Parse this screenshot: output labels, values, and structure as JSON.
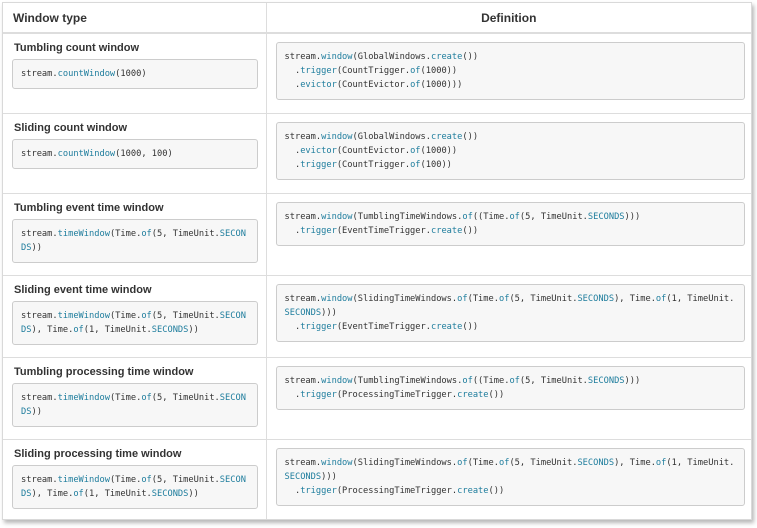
{
  "header": {
    "col1": "Window type",
    "col2": "Definition"
  },
  "rows": [
    {
      "title": "Tumbling count window",
      "example": [
        [
          "t",
          "stream."
        ],
        [
          "k",
          "countWindow"
        ],
        [
          "t",
          "(1000)"
        ]
      ],
      "definition": [
        [
          "t",
          "stream."
        ],
        [
          "k",
          "window"
        ],
        [
          "t",
          "(GlobalWindows."
        ],
        [
          "k",
          "create"
        ],
        [
          "t",
          "())\n  ."
        ],
        [
          "k",
          "trigger"
        ],
        [
          "t",
          "(CountTrigger."
        ],
        [
          "k",
          "of"
        ],
        [
          "t",
          "(1000))\n  ."
        ],
        [
          "k",
          "evictor"
        ],
        [
          "t",
          "(CountEvictor."
        ],
        [
          "k",
          "of"
        ],
        [
          "t",
          "(1000)))"
        ]
      ]
    },
    {
      "title": "Sliding count window",
      "example": [
        [
          "t",
          "stream."
        ],
        [
          "k",
          "countWindow"
        ],
        [
          "t",
          "(1000, 100)"
        ]
      ],
      "definition": [
        [
          "t",
          "stream."
        ],
        [
          "k",
          "window"
        ],
        [
          "t",
          "(GlobalWindows."
        ],
        [
          "k",
          "create"
        ],
        [
          "t",
          "())\n  ."
        ],
        [
          "k",
          "evictor"
        ],
        [
          "t",
          "(CountEvictor."
        ],
        [
          "k",
          "of"
        ],
        [
          "t",
          "(1000))\n  ."
        ],
        [
          "k",
          "trigger"
        ],
        [
          "t",
          "(CountTrigger."
        ],
        [
          "k",
          "of"
        ],
        [
          "t",
          "(100))"
        ]
      ]
    },
    {
      "title": "Tumbling event time window",
      "example": [
        [
          "t",
          "stream."
        ],
        [
          "k",
          "timeWindow"
        ],
        [
          "t",
          "(Time."
        ],
        [
          "k",
          "of"
        ],
        [
          "t",
          "(5, TimeUnit."
        ],
        [
          "k",
          "SECONDS"
        ],
        [
          "t",
          "))"
        ]
      ],
      "definition": [
        [
          "t",
          "stream."
        ],
        [
          "k",
          "window"
        ],
        [
          "t",
          "(TumblingTimeWindows."
        ],
        [
          "k",
          "of"
        ],
        [
          "t",
          "((Time."
        ],
        [
          "k",
          "of"
        ],
        [
          "t",
          "(5, TimeUnit."
        ],
        [
          "k",
          "SECONDS"
        ],
        [
          "t",
          ")))\n  ."
        ],
        [
          "k",
          "trigger"
        ],
        [
          "t",
          "(EventTimeTrigger."
        ],
        [
          "k",
          "create"
        ],
        [
          "t",
          "())"
        ]
      ]
    },
    {
      "title": "Sliding event time window",
      "example": [
        [
          "t",
          "stream."
        ],
        [
          "k",
          "timeWindow"
        ],
        [
          "t",
          "(Time."
        ],
        [
          "k",
          "of"
        ],
        [
          "t",
          "(5, TimeUnit."
        ],
        [
          "k",
          "SECONDS"
        ],
        [
          "t",
          "), Time."
        ],
        [
          "k",
          "of"
        ],
        [
          "t",
          "(1, TimeUnit."
        ],
        [
          "k",
          "SECONDS"
        ],
        [
          "t",
          "))"
        ]
      ],
      "definition": [
        [
          "t",
          "stream."
        ],
        [
          "k",
          "window"
        ],
        [
          "t",
          "(SlidingTimeWindows."
        ],
        [
          "k",
          "of"
        ],
        [
          "t",
          "(Time."
        ],
        [
          "k",
          "of"
        ],
        [
          "t",
          "(5, TimeUnit."
        ],
        [
          "k",
          "SECONDS"
        ],
        [
          "t",
          "), Time."
        ],
        [
          "k",
          "of"
        ],
        [
          "t",
          "(1, TimeUnit."
        ],
        [
          "k",
          "SECONDS"
        ],
        [
          "t",
          ")))\n  ."
        ],
        [
          "k",
          "trigger"
        ],
        [
          "t",
          "(EventTimeTrigger."
        ],
        [
          "k",
          "create"
        ],
        [
          "t",
          "())"
        ]
      ]
    },
    {
      "title": "Tumbling processing time window",
      "example": [
        [
          "t",
          "stream."
        ],
        [
          "k",
          "timeWindow"
        ],
        [
          "t",
          "(Time."
        ],
        [
          "k",
          "of"
        ],
        [
          "t",
          "(5, TimeUnit."
        ],
        [
          "k",
          "SECONDS"
        ],
        [
          "t",
          "))"
        ]
      ],
      "definition": [
        [
          "t",
          "stream."
        ],
        [
          "k",
          "window"
        ],
        [
          "t",
          "(TumblingTimeWindows."
        ],
        [
          "k",
          "of"
        ],
        [
          "t",
          "((Time."
        ],
        [
          "k",
          "of"
        ],
        [
          "t",
          "(5, TimeUnit."
        ],
        [
          "k",
          "SECONDS"
        ],
        [
          "t",
          ")))\n  ."
        ],
        [
          "k",
          "trigger"
        ],
        [
          "t",
          "(ProcessingTimeTrigger."
        ],
        [
          "k",
          "create"
        ],
        [
          "t",
          "())"
        ]
      ]
    },
    {
      "title": "Sliding processing time window",
      "example": [
        [
          "t",
          "stream."
        ],
        [
          "k",
          "timeWindow"
        ],
        [
          "t",
          "(Time."
        ],
        [
          "k",
          "of"
        ],
        [
          "t",
          "(5, TimeUnit."
        ],
        [
          "k",
          "SECONDS"
        ],
        [
          "t",
          "), Time."
        ],
        [
          "k",
          "of"
        ],
        [
          "t",
          "(1, TimeUnit."
        ],
        [
          "k",
          "SECONDS"
        ],
        [
          "t",
          "))"
        ]
      ],
      "definition": [
        [
          "t",
          "stream."
        ],
        [
          "k",
          "window"
        ],
        [
          "t",
          "(SlidingTimeWindows."
        ],
        [
          "k",
          "of"
        ],
        [
          "t",
          "(Time."
        ],
        [
          "k",
          "of"
        ],
        [
          "t",
          "(5, TimeUnit."
        ],
        [
          "k",
          "SECONDS"
        ],
        [
          "t",
          "), Time."
        ],
        [
          "k",
          "of"
        ],
        [
          "t",
          "(1, TimeUnit."
        ],
        [
          "k",
          "SECONDS"
        ],
        [
          "t",
          ")))\n  ."
        ],
        [
          "k",
          "trigger"
        ],
        [
          "t",
          "(ProcessingTimeTrigger."
        ],
        [
          "k",
          "create"
        ],
        [
          "t",
          "())"
        ]
      ]
    }
  ],
  "colors": {
    "keyword": "#1e7d9d",
    "code_bg": "#f7f7f7",
    "border": "#dddddd"
  }
}
